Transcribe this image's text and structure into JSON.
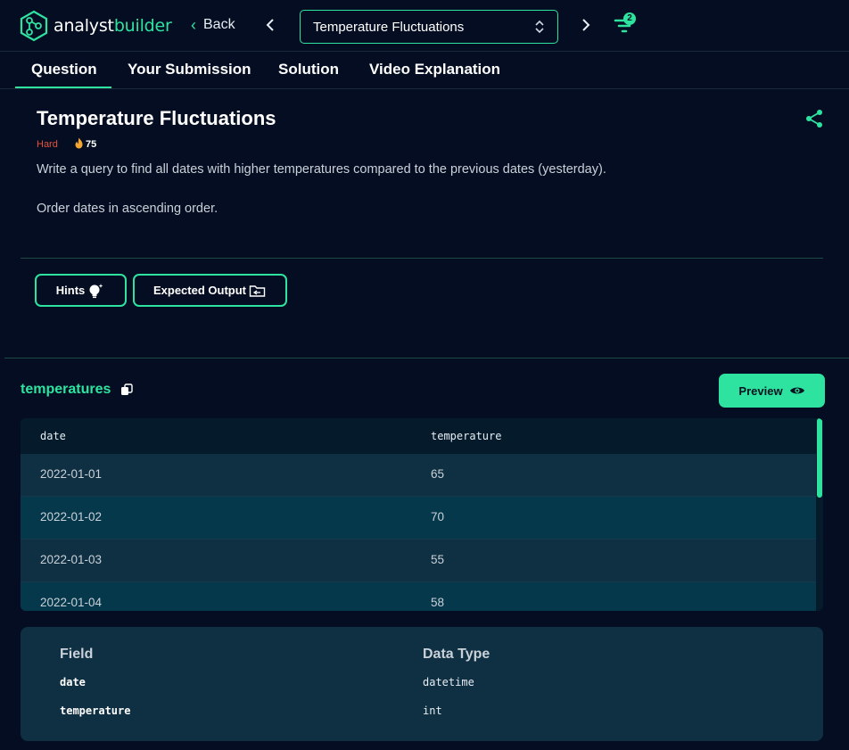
{
  "brand": {
    "name_plain": "analyst",
    "name_accent": "builder"
  },
  "nav": {
    "back_label": "Back",
    "question_select": "Temperature Fluctuations",
    "filter_badge": "2"
  },
  "tabs": [
    {
      "label": "Question",
      "active": true
    },
    {
      "label": "Your Submission"
    },
    {
      "label": "Solution"
    },
    {
      "label": "Video Explanation"
    }
  ],
  "question": {
    "title": "Temperature Fluctuations",
    "difficulty": "Hard",
    "points": "75",
    "description": "Write a query to find all dates with higher temperatures compared to the previous dates (yesterday).",
    "order_note": "Order dates in ascending order."
  },
  "buttons": {
    "hints": "Hints",
    "expected_output": "Expected Output",
    "preview": "Preview"
  },
  "table": {
    "name": "temperatures",
    "columns": [
      "date",
      "temperature"
    ],
    "rows": [
      [
        "2022-01-01",
        "65"
      ],
      [
        "2022-01-02",
        "70"
      ],
      [
        "2022-01-03",
        "55"
      ],
      [
        "2022-01-04",
        "58"
      ]
    ]
  },
  "schema": {
    "headers": [
      "Field",
      "Data Type"
    ],
    "fields": [
      {
        "name": "date",
        "type": "datetime"
      },
      {
        "name": "temperature",
        "type": "int"
      }
    ]
  },
  "colors": {
    "accent": "#2ee3a0",
    "background": "#040d21",
    "panel": "#0f2f42",
    "difficulty_hard": "#e5533d"
  },
  "icons": [
    "logo-icon",
    "chevron-left-icon",
    "chevron-right-icon",
    "up-down-icon",
    "filter-icon",
    "share-icon",
    "flame-icon",
    "lightbulb-icon",
    "folder-icon",
    "copy-icon",
    "eye-icon"
  ]
}
